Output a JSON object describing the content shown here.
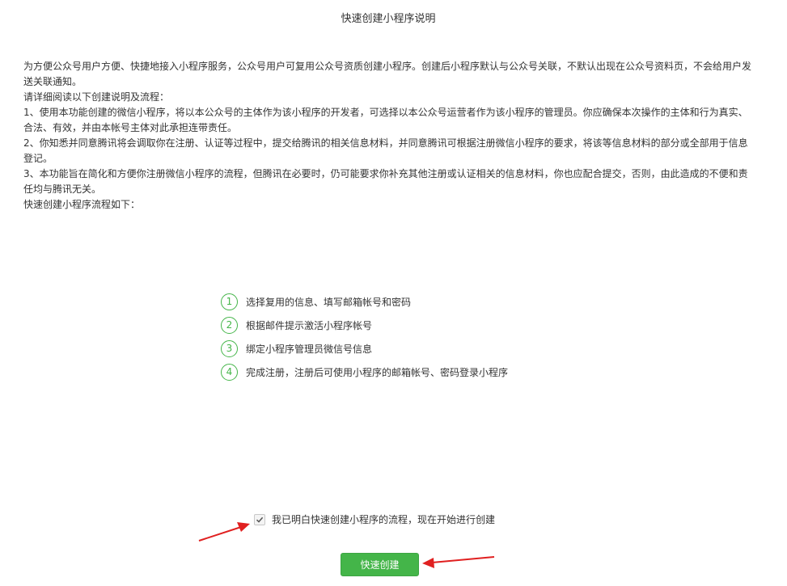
{
  "page": {
    "title": "快速创建小程序说明"
  },
  "content": {
    "intro": "为方便公众号用户方便、快捷地接入小程序服务，公众号用户可复用公众号资质创建小程序。创建后小程序默认与公众号关联，不默认出现在公众号资料页，不会给用户发送关联通知。",
    "read_title": "请详细阅读以下创建说明及流程：",
    "rules": [
      "1、使用本功能创建的微信小程序，将以本公众号的主体作为该小程序的开发者，可选择以本公众号运营者作为该小程序的管理员。你应确保本次操作的主体和行为真实、合法、有效，并由本帐号主体对此承担连带责任。",
      "2、你知悉并同意腾讯将会调取你在注册、认证等过程中，提交给腾讯的相关信息材料，并同意腾讯可根据注册微信小程序的要求，将该等信息材料的部分或全部用于信息登记。",
      "3、本功能旨在简化和方便你注册微信小程序的流程，但腾讯在必要时，仍可能要求你补充其他注册或认证相关的信息材料，你也应配合提交，否则，由此造成的不便和责任均与腾讯无关。"
    ],
    "flow_title": "快速创建小程序流程如下："
  },
  "steps": [
    {
      "num": "1",
      "text": "选择复用的信息、填写邮箱帐号和密码"
    },
    {
      "num": "2",
      "text": "根据邮件提示激活小程序帐号"
    },
    {
      "num": "3",
      "text": "绑定小程序管理员微信号信息"
    },
    {
      "num": "4",
      "text": "完成注册，注册后可使用小程序的邮箱帐号、密码登录小程序"
    }
  ],
  "agreement": {
    "checked": true,
    "label": "我已明白快速创建小程序的流程，现在开始进行创建"
  },
  "actions": {
    "create_label": "快速创建"
  },
  "colors": {
    "accent": "#44b549",
    "annotation": "#e02020"
  }
}
